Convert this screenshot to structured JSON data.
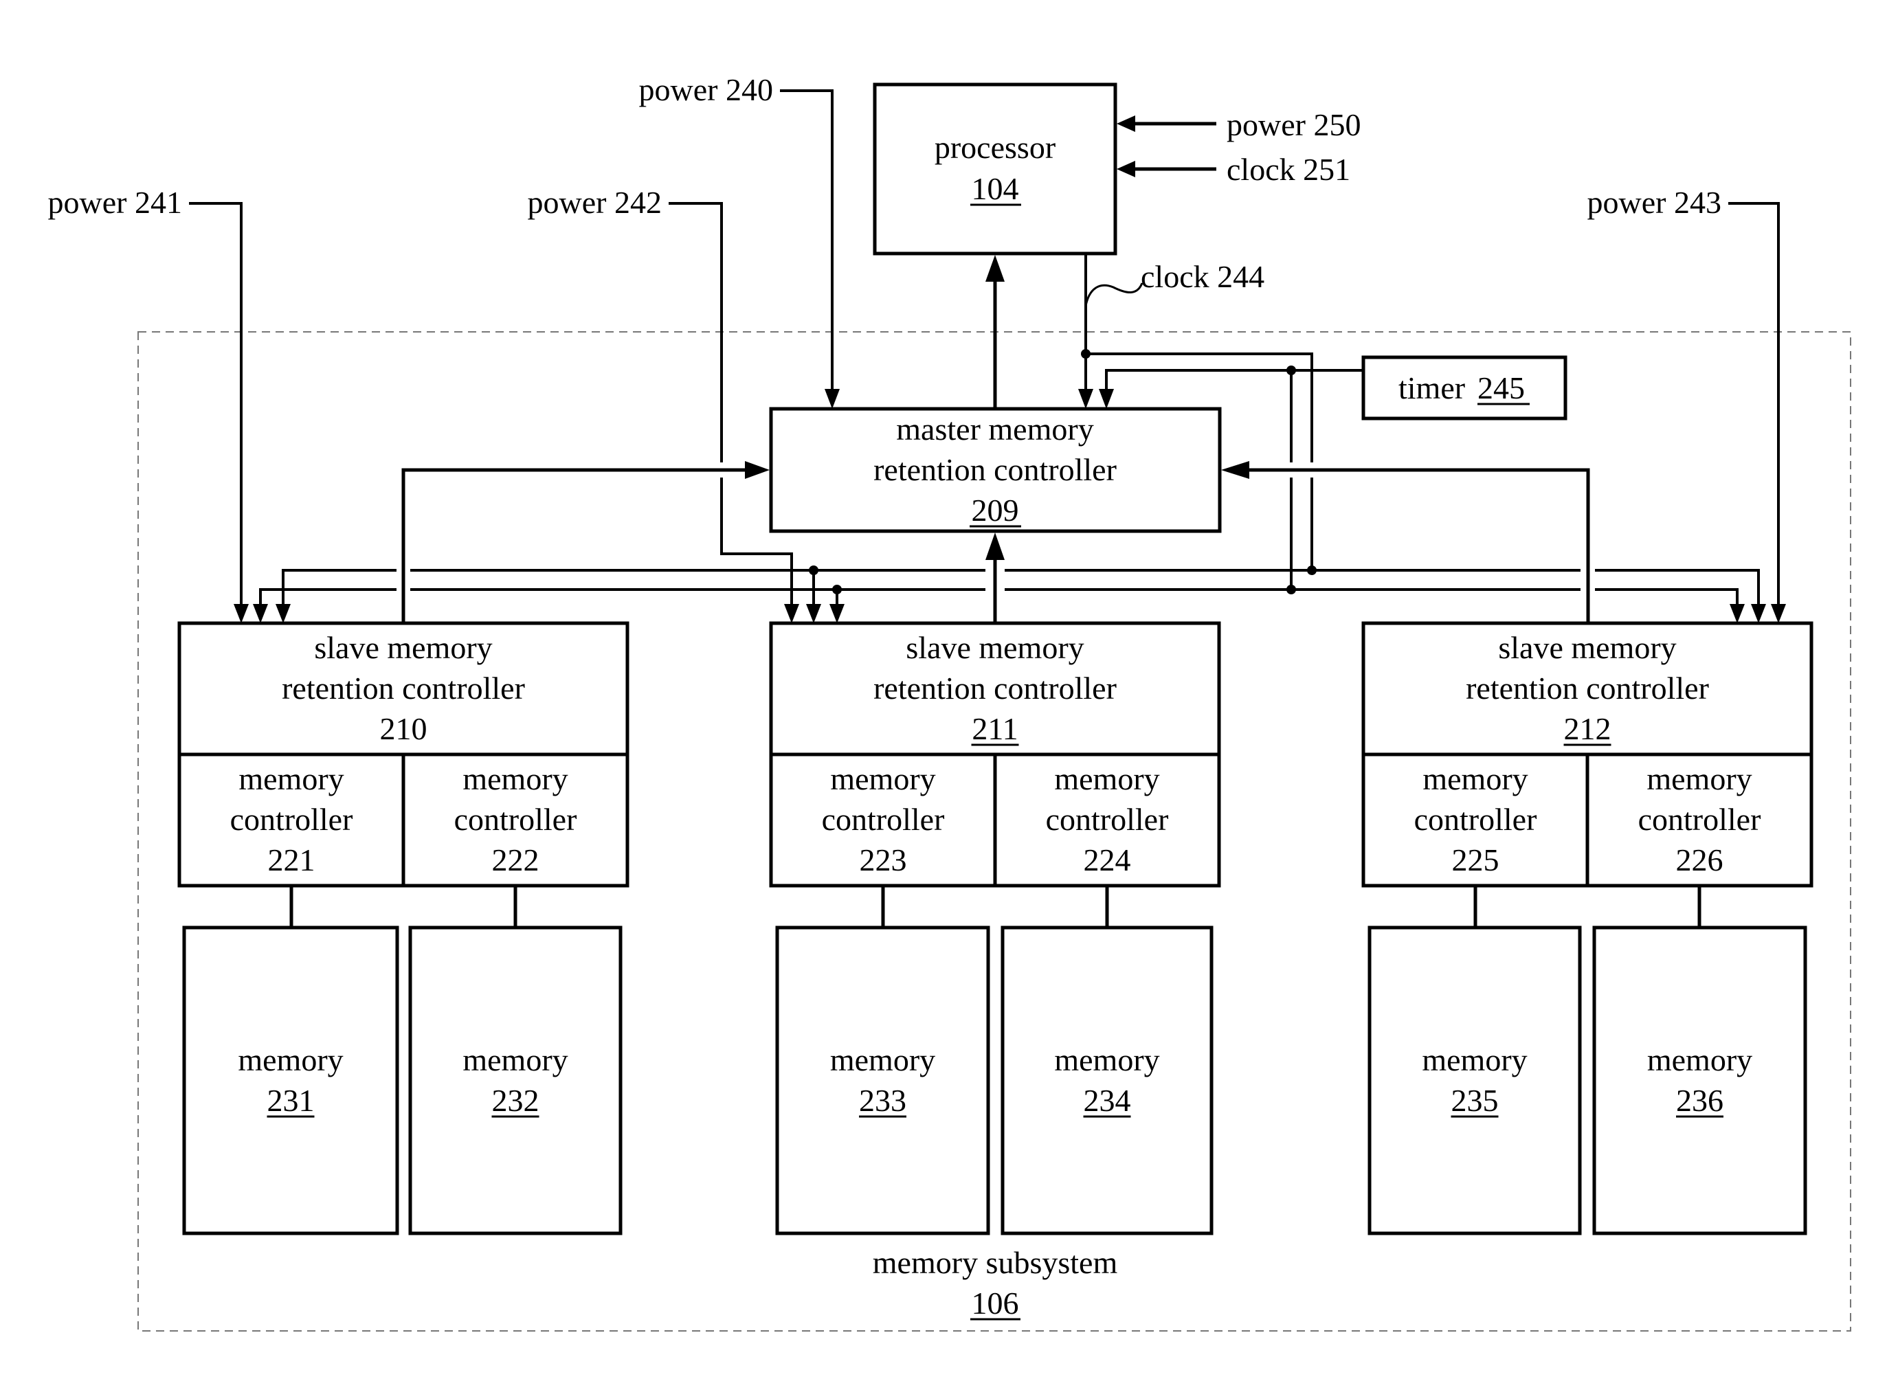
{
  "figure": {
    "subsystem": {
      "label": "memory subsystem",
      "ref": "106",
      "ref_underlined": true
    },
    "processor": {
      "label": "processor",
      "ref": "104",
      "ref_underlined": true
    },
    "timer": {
      "label": "timer",
      "ref": "245",
      "ref_underlined": true
    },
    "master": {
      "line1": "master memory",
      "line2": "retention controller",
      "ref": "209",
      "ref_underlined": true
    },
    "slaves": [
      {
        "line1": "slave memory",
        "line2": "retention controller",
        "ref": "210",
        "ref_underlined": false
      },
      {
        "line1": "slave memory",
        "line2": "retention controller",
        "ref": "211",
        "ref_underlined": true
      },
      {
        "line1": "slave memory",
        "line2": "retention controller",
        "ref": "212",
        "ref_underlined": true
      }
    ],
    "memory_controllers": [
      {
        "line1": "memory",
        "line2": "controller",
        "ref": "221"
      },
      {
        "line1": "memory",
        "line2": "controller",
        "ref": "222"
      },
      {
        "line1": "memory",
        "line2": "controller",
        "ref": "223"
      },
      {
        "line1": "memory",
        "line2": "controller",
        "ref": "224"
      },
      {
        "line1": "memory",
        "line2": "controller",
        "ref": "225"
      },
      {
        "line1": "memory",
        "line2": "controller",
        "ref": "226"
      }
    ],
    "memories": [
      {
        "label": "memory",
        "ref": "231"
      },
      {
        "label": "memory",
        "ref": "232"
      },
      {
        "label": "memory",
        "ref": "233"
      },
      {
        "label": "memory",
        "ref": "234"
      },
      {
        "label": "memory",
        "ref": "235"
      },
      {
        "label": "memory",
        "ref": "236"
      }
    ],
    "signals": {
      "power_240": "power 240",
      "power_241": "power 241",
      "power_242": "power 242",
      "power_243": "power 243",
      "power_250": "power 250",
      "clock_251": "clock 251",
      "clock_244": "clock 244"
    }
  }
}
